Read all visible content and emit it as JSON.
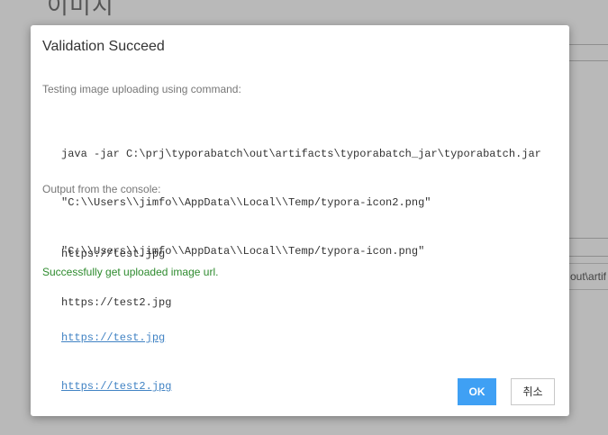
{
  "background": {
    "title": "이미지",
    "field_value": "out\\artif"
  },
  "dialog": {
    "title": "Validation Succeed",
    "command_label": "Testing image uploading using command:",
    "command_lines": [
      "java -jar C:\\prj\\typorabatch\\out\\artifacts\\typorabatch_jar\\typorabatch.jar",
      "\"C:\\\\Users\\\\jimfo\\\\AppData\\\\Local\\\\Temp/typora-icon2.png\"",
      "\"C:\\\\Users\\\\jimfo\\\\AppData\\\\Local\\\\Temp/typora-icon.png\""
    ],
    "output_label": "Output from the console:",
    "output_lines": [
      "https://test.jpg",
      "https://test2.jpg"
    ],
    "success_label": "Successfully get uploaded image url.",
    "links": [
      "https://test.jpg",
      "https://test2.jpg"
    ],
    "ok_label": "OK",
    "cancel_label": "취소"
  },
  "colors": {
    "accent": "#3fa0f4",
    "success": "#2e8b2e",
    "link": "#4183c4"
  }
}
